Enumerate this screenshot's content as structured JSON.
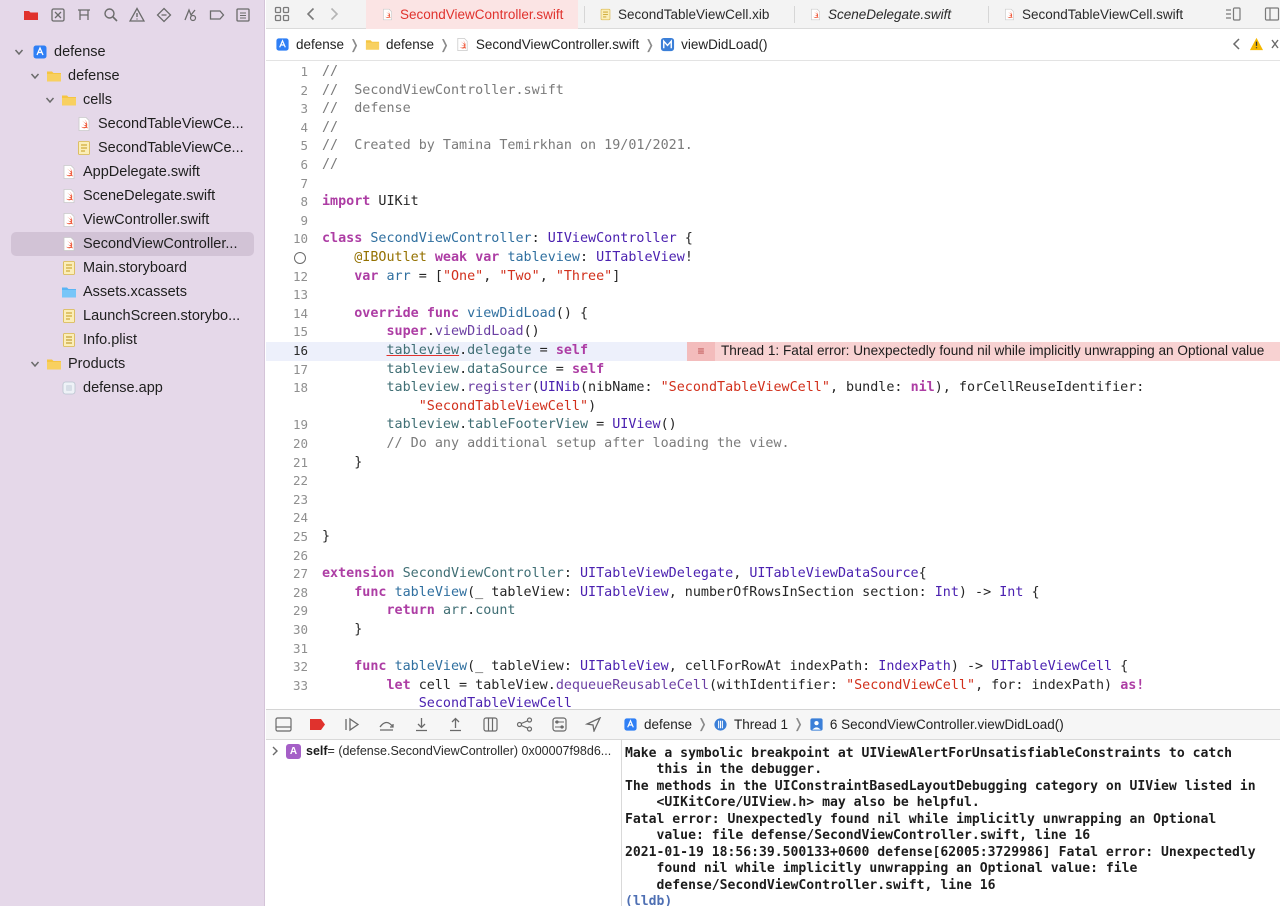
{
  "navigator": {
    "icons": [
      "folder-icon",
      "source-control-icon",
      "symbol-icon",
      "search-icon",
      "warning-icon",
      "test-icon",
      "debug-icon",
      "breakpoint-icon",
      "report-icon"
    ],
    "tree": [
      {
        "label": "defense",
        "type": "project",
        "level": 0,
        "disclosure": "open"
      },
      {
        "label": "defense",
        "type": "folder",
        "level": 1,
        "disclosure": "open"
      },
      {
        "label": "cells",
        "type": "folder",
        "level": 2,
        "disclosure": "open"
      },
      {
        "label": "SecondTableViewCe...",
        "type": "swift",
        "level": 3
      },
      {
        "label": "SecondTableViewCe...",
        "type": "xib",
        "level": 3
      },
      {
        "label": "AppDelegate.swift",
        "type": "swift",
        "level": 2
      },
      {
        "label": "SceneDelegate.swift",
        "type": "swift",
        "level": 2
      },
      {
        "label": "ViewController.swift",
        "type": "swift",
        "level": 2
      },
      {
        "label": "SecondViewController...",
        "type": "swift",
        "level": 2,
        "selected": true
      },
      {
        "label": "Main.storyboard",
        "type": "storyboard",
        "level": 2
      },
      {
        "label": "Assets.xcassets",
        "type": "assets",
        "level": 2
      },
      {
        "label": "LaunchScreen.storybo...",
        "type": "storyboard",
        "level": 2
      },
      {
        "label": "Info.plist",
        "type": "plist",
        "level": 2
      },
      {
        "label": "Products",
        "type": "folder",
        "level": 1,
        "disclosure": "open"
      },
      {
        "label": "defense.app",
        "type": "app",
        "level": 2
      }
    ]
  },
  "tabs": [
    {
      "label": "SecondViewController.swift",
      "type": "swift",
      "active": true
    },
    {
      "label": "SecondTableViewCell.xib",
      "type": "xib"
    },
    {
      "label": "SceneDelegate.swift",
      "type": "swift",
      "italic": true
    },
    {
      "label": "SecondTableViewCell.swift",
      "type": "swift"
    }
  ],
  "jumpbar": {
    "crumbs": [
      {
        "label": "defense",
        "type": "project"
      },
      {
        "label": "defense",
        "type": "folder"
      },
      {
        "label": "SecondViewController.swift",
        "type": "swift"
      },
      {
        "label": "viewDidLoad()",
        "type": "method"
      }
    ]
  },
  "editor": {
    "current_line": 16,
    "lines": [
      {
        "n": "1",
        "tokens": [
          [
            "c",
            "//"
          ]
        ]
      },
      {
        "n": "2",
        "tokens": [
          [
            "c",
            "//  SecondViewController.swift"
          ]
        ]
      },
      {
        "n": "3",
        "tokens": [
          [
            "c",
            "//  defense"
          ]
        ]
      },
      {
        "n": "4",
        "tokens": [
          [
            "c",
            "//"
          ]
        ]
      },
      {
        "n": "5",
        "tokens": [
          [
            "c",
            "//  Created by Tamina Temirkhan on 19/01/2021."
          ]
        ]
      },
      {
        "n": "6",
        "tokens": [
          [
            "c",
            "//"
          ]
        ]
      },
      {
        "n": "7",
        "tokens": []
      },
      {
        "n": "8",
        "tokens": [
          [
            "k",
            "import"
          ],
          [
            "p",
            " UIKit"
          ]
        ]
      },
      {
        "n": "9",
        "tokens": []
      },
      {
        "n": "10",
        "tokens": [
          [
            "k",
            "class"
          ],
          [
            "p",
            " "
          ],
          [
            "d",
            "SecondViewController"
          ],
          [
            "p",
            ": "
          ],
          [
            "t",
            "UIViewController"
          ],
          [
            "p",
            " {"
          ]
        ]
      },
      {
        "n": "",
        "outlet": true,
        "tokens": [
          [
            "p",
            "    "
          ],
          [
            "a",
            "@IBOutlet"
          ],
          [
            "p",
            " "
          ],
          [
            "k",
            "weak"
          ],
          [
            "p",
            " "
          ],
          [
            "k",
            "var"
          ],
          [
            "p",
            " "
          ],
          [
            "d",
            "tableview"
          ],
          [
            "p",
            ": "
          ],
          [
            "t",
            "UITableView"
          ],
          [
            "p",
            "!"
          ]
        ]
      },
      {
        "n": "12",
        "tokens": [
          [
            "p",
            "    "
          ],
          [
            "k",
            "var"
          ],
          [
            "p",
            " "
          ],
          [
            "d",
            "arr"
          ],
          [
            "p",
            " = ["
          ],
          [
            "s",
            "\"One\""
          ],
          [
            "p",
            ", "
          ],
          [
            "s",
            "\"Two\""
          ],
          [
            "p",
            ", "
          ],
          [
            "s",
            "\"Three\""
          ],
          [
            "p",
            "]"
          ]
        ]
      },
      {
        "n": "13",
        "tokens": []
      },
      {
        "n": "14",
        "tokens": [
          [
            "p",
            "    "
          ],
          [
            "k",
            "override"
          ],
          [
            "p",
            " "
          ],
          [
            "k",
            "func"
          ],
          [
            "p",
            " "
          ],
          [
            "d",
            "viewDidLoad"
          ],
          [
            "p",
            "() {"
          ]
        ]
      },
      {
        "n": "15",
        "tokens": [
          [
            "p",
            "        "
          ],
          [
            "k",
            "super"
          ],
          [
            "p",
            "."
          ],
          [
            "f",
            "viewDidLoad"
          ],
          [
            "p",
            "()"
          ]
        ]
      },
      {
        "n": "16",
        "tokens": [
          [
            "p",
            "        "
          ],
          [
            "mu",
            "tableview"
          ],
          [
            "p",
            "."
          ],
          [
            "m",
            "delegate"
          ],
          [
            "p",
            " = "
          ],
          [
            "k",
            "self"
          ]
        ]
      },
      {
        "n": "17",
        "tokens": [
          [
            "p",
            "        "
          ],
          [
            "m",
            "tableview"
          ],
          [
            "p",
            "."
          ],
          [
            "m",
            "dataSource"
          ],
          [
            "p",
            " = "
          ],
          [
            "k",
            "self"
          ]
        ]
      },
      {
        "n": "18",
        "tokens": [
          [
            "p",
            "        "
          ],
          [
            "m",
            "tableview"
          ],
          [
            "p",
            "."
          ],
          [
            "f",
            "register"
          ],
          [
            "p",
            "("
          ],
          [
            "t",
            "UINib"
          ],
          [
            "p",
            "(nibName: "
          ],
          [
            "s",
            "\"SecondTableViewCell\""
          ],
          [
            "p",
            ", bundle: "
          ],
          [
            "k",
            "nil"
          ],
          [
            "p",
            "), forCellReuseIdentifier:"
          ]
        ]
      },
      {
        "n": "",
        "tokens": [
          [
            "p",
            "            "
          ],
          [
            "s",
            "\"SecondTableViewCell\""
          ],
          [
            "p",
            ")"
          ]
        ]
      },
      {
        "n": "19",
        "tokens": [
          [
            "p",
            "        "
          ],
          [
            "m",
            "tableview"
          ],
          [
            "p",
            "."
          ],
          [
            "m",
            "tableFooterView"
          ],
          [
            "p",
            " = "
          ],
          [
            "t",
            "UIView"
          ],
          [
            "p",
            "()"
          ]
        ]
      },
      {
        "n": "20",
        "tokens": [
          [
            "c",
            "        // Do any additional setup after loading the view."
          ]
        ]
      },
      {
        "n": "21",
        "tokens": [
          [
            "p",
            "    }"
          ]
        ]
      },
      {
        "n": "22",
        "tokens": []
      },
      {
        "n": "23",
        "tokens": []
      },
      {
        "n": "24",
        "tokens": []
      },
      {
        "n": "25",
        "tokens": [
          [
            "p",
            "}"
          ]
        ]
      },
      {
        "n": "26",
        "tokens": []
      },
      {
        "n": "27",
        "tokens": [
          [
            "k",
            "extension"
          ],
          [
            "p",
            " "
          ],
          [
            "m",
            "SecondViewController"
          ],
          [
            "p",
            ": "
          ],
          [
            "t",
            "UITableViewDelegate"
          ],
          [
            "p",
            ", "
          ],
          [
            "t",
            "UITableViewDataSource"
          ],
          [
            "p",
            "{"
          ]
        ]
      },
      {
        "n": "28",
        "tokens": [
          [
            "p",
            "    "
          ],
          [
            "k",
            "func"
          ],
          [
            "p",
            " "
          ],
          [
            "d",
            "tableView"
          ],
          [
            "p",
            "(_ tableView: "
          ],
          [
            "t",
            "UITableView"
          ],
          [
            "p",
            ", numberOfRowsInSection section: "
          ],
          [
            "t",
            "Int"
          ],
          [
            "p",
            ") -> "
          ],
          [
            "t",
            "Int"
          ],
          [
            "p",
            " {"
          ]
        ]
      },
      {
        "n": "29",
        "tokens": [
          [
            "p",
            "        "
          ],
          [
            "k",
            "return"
          ],
          [
            "p",
            " "
          ],
          [
            "m",
            "arr"
          ],
          [
            "p",
            "."
          ],
          [
            "m",
            "count"
          ]
        ]
      },
      {
        "n": "30",
        "tokens": [
          [
            "p",
            "    }"
          ]
        ]
      },
      {
        "n": "31",
        "tokens": []
      },
      {
        "n": "32",
        "tokens": [
          [
            "p",
            "    "
          ],
          [
            "k",
            "func"
          ],
          [
            "p",
            " "
          ],
          [
            "d",
            "tableView"
          ],
          [
            "p",
            "(_ tableView: "
          ],
          [
            "t",
            "UITableView"
          ],
          [
            "p",
            ", cellForRowAt indexPath: "
          ],
          [
            "t",
            "IndexPath"
          ],
          [
            "p",
            ") -> "
          ],
          [
            "t",
            "UITableViewCell"
          ],
          [
            "p",
            " {"
          ]
        ]
      },
      {
        "n": "33",
        "tokens": [
          [
            "p",
            "        "
          ],
          [
            "k",
            "let"
          ],
          [
            "p",
            " cell = tableView."
          ],
          [
            "f",
            "dequeueReusableCell"
          ],
          [
            "p",
            "(withIdentifier: "
          ],
          [
            "s",
            "\"SecondViewCell\""
          ],
          [
            "p",
            ", for: indexPath) "
          ],
          [
            "k",
            "as!"
          ]
        ]
      },
      {
        "n": "",
        "tokens": [
          [
            "p",
            "            "
          ],
          [
            "t",
            "SecondTableViewCell"
          ]
        ]
      }
    ],
    "error_banner": {
      "text": "Thread 1: Fatal error: Unexpectedly found nil while implicitly unwrapping an Optional value",
      "line": 16
    }
  },
  "debug_bar": {
    "crumbs": [
      {
        "label": "defense",
        "type": "project"
      },
      {
        "label": "Thread 1",
        "type": "thread"
      },
      {
        "label": "6 SecondViewController.viewDidLoad()",
        "type": "frame"
      }
    ]
  },
  "variables": {
    "rows": [
      {
        "badge": "A",
        "name": "self",
        "value": " = (defense.SecondViewController) 0x00007f98d6..."
      }
    ]
  },
  "console": {
    "lines": [
      "Make a symbolic breakpoint at UIViewAlertForUnsatisfiableConstraints to catch",
      "    this in the debugger.",
      "The methods in the UIConstraintBasedLayoutDebugging category on UIView listed in",
      "    <UIKitCore/UIView.h> may also be helpful.",
      "Fatal error: Unexpectedly found nil while implicitly unwrapping an Optional",
      "    value: file defense/SecondViewController.swift, line 16",
      "2021-01-19 18:56:39.500133+0600 defense[62005:3729986] Fatal error: Unexpectedly",
      "    found nil while implicitly unwrapping an Optional value: file",
      "    defense/SecondViewController.swift, line 16"
    ],
    "prompt": "(lldb)"
  },
  "colors": {
    "sidebar_bg": "#e5d8e9",
    "selection": "#d2c3d6",
    "active_tab": "#e0322d",
    "error_banner": "#f8d2d2",
    "current_line": "#edf0fb",
    "swift_icon": "#ef5a3c",
    "folder_icon": "#f5c542"
  }
}
